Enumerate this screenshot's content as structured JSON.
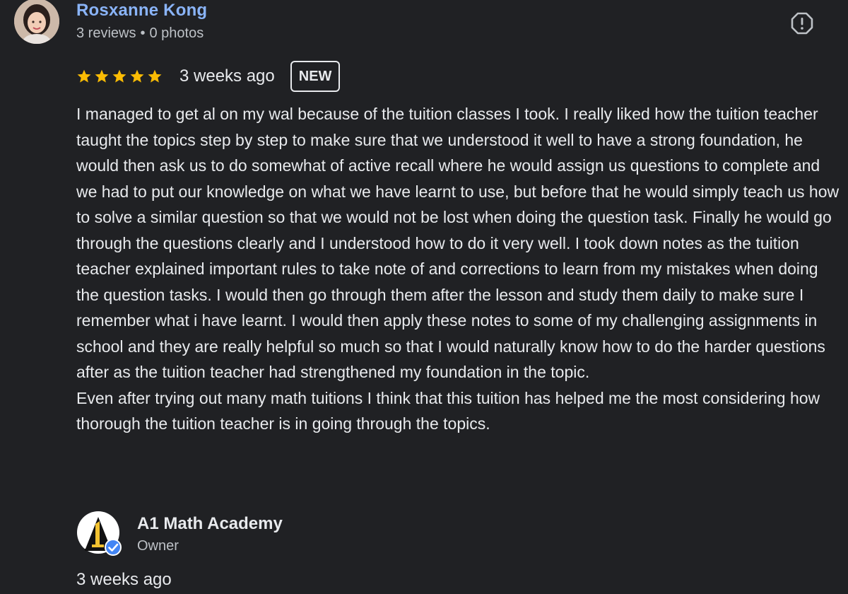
{
  "reviewer": {
    "name": "Rosxanne Kong",
    "reviews": "3 reviews",
    "separator": "•",
    "photos": "0 photos"
  },
  "rating": {
    "stars": 5,
    "max_stars": 5,
    "star_icon": "star-icon",
    "star_color": "#fbbc04"
  },
  "review": {
    "date": "3 weeks ago",
    "badge": "NEW",
    "text": "I managed to get al on my wal because of the tuition classes I took. I really liked how the tuition teacher taught the topics step by step to make sure that we understood it well to have a strong foundation, he would then ask us to do somewhat of active recall where he would assign us questions to complete and we had to put our knowledge on what we have learnt to use, but before that he would simply teach us how to solve a similar question so that we would not be lost when doing the question task. Finally he would go through the questions clearly and I understood how to do it very well. I took down notes as the tuition teacher explained important rules to take note of and corrections to learn from my mistakes when doing the question tasks. I would then go through them after the lesson and study them daily to make sure I remember what i have learnt. I would then apply these notes to some of my challenging assignments in school and they are really helpful so much so that I would naturally know how to do the harder questions after as the tuition teacher had strengthened my foundation in the topic.\nEven after trying out many math tuitions I think that this tuition has helped me the most considering how thorough the tuition teacher is in going through the topics."
  },
  "owner_response": {
    "name": "A1 Math Academy",
    "role": "Owner",
    "date": "3 weeks ago",
    "logo_icon": "a1-math-academy-logo",
    "verified_icon": "verified-badge-icon",
    "verified_color": "#4285f4"
  },
  "icons": {
    "report": "report-flag-icon"
  },
  "colors": {
    "background": "#202124",
    "name_link": "#8ab4f8",
    "text": "#e8eaed",
    "secondary_text": "#bdc1c6"
  }
}
